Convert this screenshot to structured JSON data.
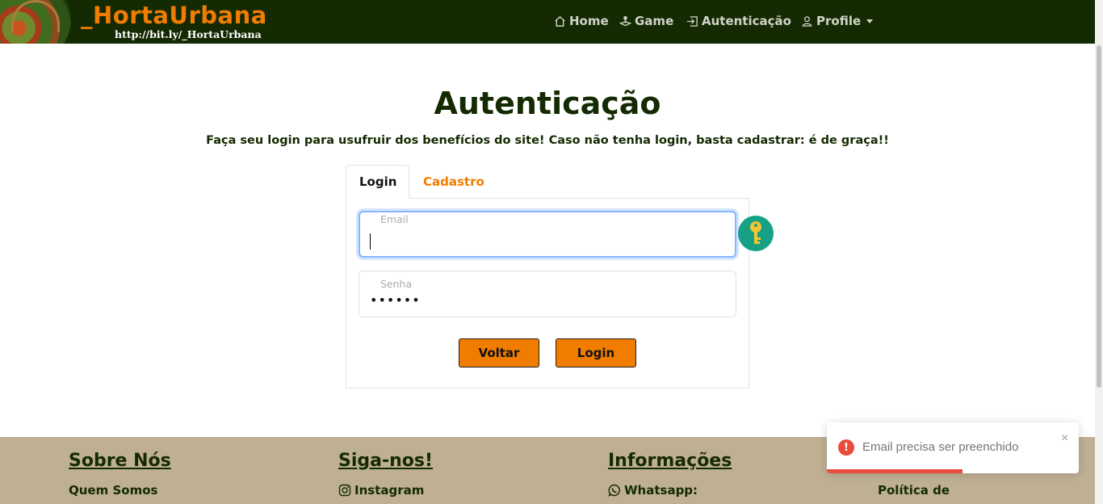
{
  "navbar": {
    "brand": "_HortaUrbana",
    "brand_url": "http://bit.ly/_HortaUrbana",
    "items": [
      {
        "label": "Home",
        "icon": "home-icon"
      },
      {
        "label": "Game",
        "icon": "joystick-icon"
      },
      {
        "label": "Autenticação",
        "icon": "login-icon"
      },
      {
        "label": "Profile",
        "icon": "person-icon"
      }
    ]
  },
  "page": {
    "title": "Autenticação",
    "subtitle": "Faça seu login para usufruir dos benefícios do site! Caso não tenha login, basta cadastrar: é de graça!!"
  },
  "tabs": [
    {
      "label": "Login",
      "active": true
    },
    {
      "label": "Cadastro",
      "active": false
    }
  ],
  "form": {
    "email_label": "Email",
    "email_value": "",
    "senha_label": "Senha",
    "senha_value": "••••••",
    "back_label": "Voltar",
    "login_label": "Login"
  },
  "footer": {
    "columns": [
      {
        "heading": "Sobre Nós",
        "link": "Quem Somos"
      },
      {
        "heading": "Siga-nos!",
        "link": "Instagram"
      },
      {
        "heading": "Informações",
        "link": "Whatsapp:"
      },
      {
        "heading": "",
        "link": "Política de"
      }
    ]
  },
  "toast": {
    "message": "Email precisa ser preenchido",
    "close": "×",
    "icon": "error-icon",
    "progress": 0.54,
    "color": "#e74c3c"
  },
  "colors": {
    "navbar": "#142a02",
    "accent": "#f07c00",
    "footer": "#bfb093",
    "key_button": "#16a085"
  }
}
